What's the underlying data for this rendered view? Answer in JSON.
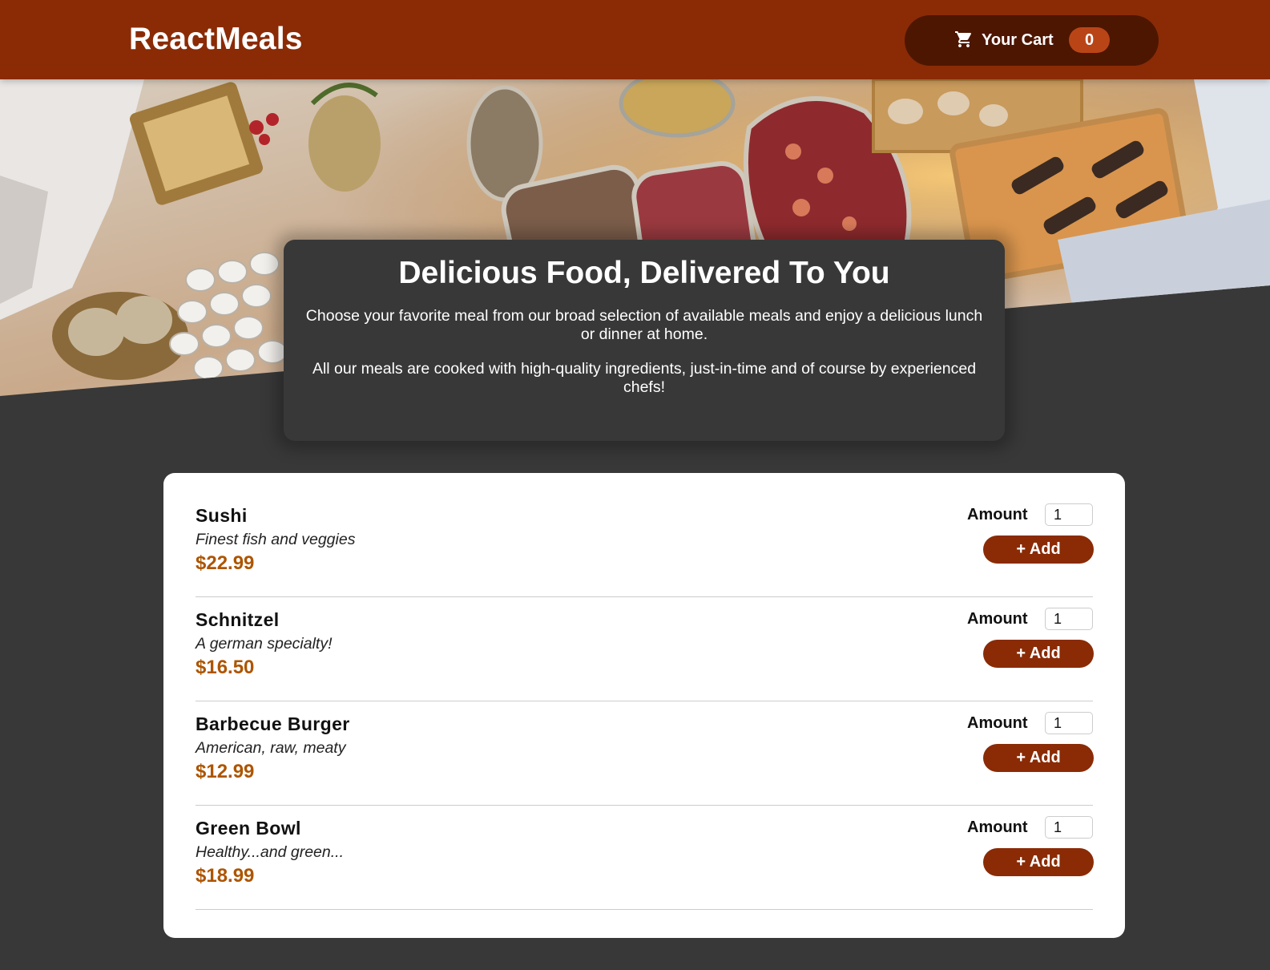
{
  "header": {
    "brand": "ReactMeals",
    "cart_label": "Your Cart",
    "cart_count": "0",
    "cart_icon": "shopping-cart-icon"
  },
  "summary": {
    "title": "Delicious Food, Delivered To You",
    "paragraph1": "Choose your favorite meal from our broad selection of available meals and enjoy a delicious lunch or dinner at home.",
    "paragraph2": "All our meals are cooked with high-quality ingredients, just-in-time and of course by experienced chefs!"
  },
  "meals": [
    {
      "name": "Sushi",
      "description": "Finest fish and veggies",
      "price": "$22.99",
      "amount_label": "Amount",
      "amount_value": "1",
      "add_label": "+ Add"
    },
    {
      "name": "Schnitzel",
      "description": "A german specialty!",
      "price": "$16.50",
      "amount_label": "Amount",
      "amount_value": "1",
      "add_label": "+ Add"
    },
    {
      "name": "Barbecue Burger",
      "description": "American, raw, meaty",
      "price": "$12.99",
      "amount_label": "Amount",
      "amount_value": "1",
      "add_label": "+ Add"
    },
    {
      "name": "Green Bowl",
      "description": "Healthy...and green...",
      "price": "$18.99",
      "amount_label": "Amount",
      "amount_value": "1",
      "add_label": "+ Add"
    }
  ],
  "colors": {
    "header_bg": "#8a2b06",
    "cart_bg": "#4d1601",
    "badge_bg": "#b94517",
    "page_bg": "#383838",
    "price": "#ad5502"
  }
}
